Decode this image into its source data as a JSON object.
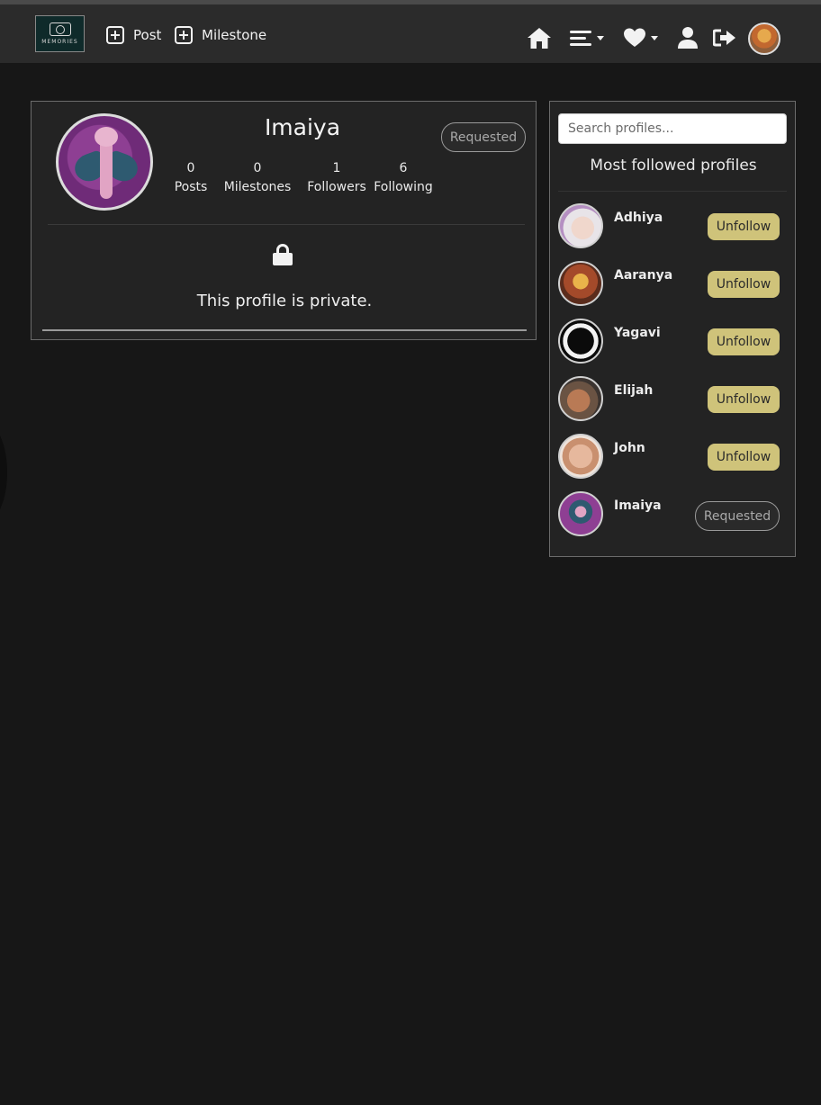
{
  "nav": {
    "logo_text": "MEMORIES",
    "post_label": "Post",
    "milestone_label": "Milestone"
  },
  "profile": {
    "name": "Imaiya",
    "request_status": "Requested",
    "stats": [
      {
        "count": "0",
        "label": "Posts"
      },
      {
        "count": "0",
        "label": "Milestones"
      },
      {
        "count": "1",
        "label": "Followers"
      },
      {
        "count": "6",
        "label": "Following"
      }
    ],
    "private_message": "This profile is private."
  },
  "sidebar": {
    "search_placeholder": "Search profiles...",
    "title": "Most followed profiles",
    "profiles": [
      {
        "name": "Adhiya",
        "action": "Unfollow"
      },
      {
        "name": "Aaranya",
        "action": "Unfollow"
      },
      {
        "name": "Yagavi",
        "action": "Unfollow"
      },
      {
        "name": "Elijah",
        "action": "Unfollow"
      },
      {
        "name": "John",
        "action": "Unfollow"
      },
      {
        "name": "Imaiya",
        "action": "Requested"
      }
    ]
  },
  "colors": {
    "background": "#171717",
    "navbar": "#2b2b2b",
    "panel": "#232323",
    "unfollow_button": "#cfc37a"
  }
}
